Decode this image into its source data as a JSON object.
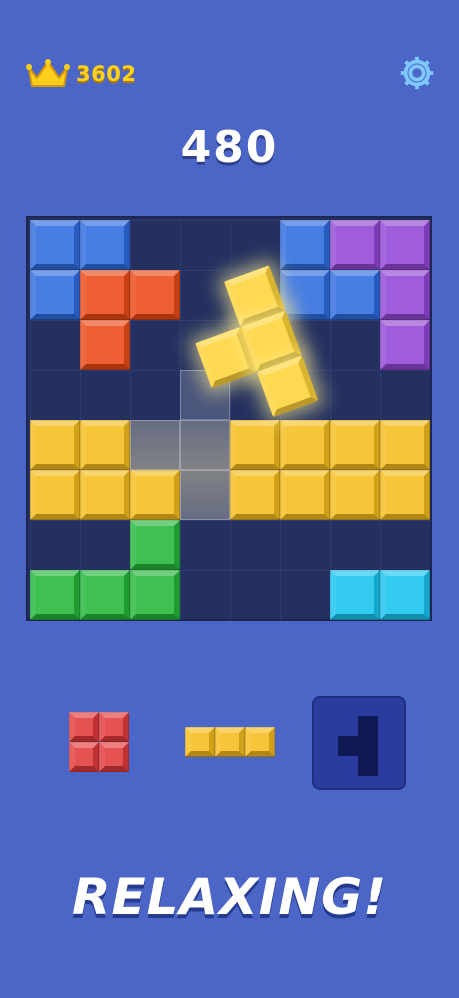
{
  "header": {
    "best_score": "3602",
    "score": "480"
  },
  "board": {
    "colors": {
      "blue": "#2f6ce0",
      "purple": "#9247d6",
      "orange": "#ec4a17",
      "yellow": "#f5bd1e",
      "green": "#25b83a",
      "cyan": "#19c4f0"
    },
    "rows": [
      [
        "blue",
        "blue",
        "",
        "",
        "",
        "blue",
        "purple",
        "purple"
      ],
      [
        "blue",
        "orange",
        "orange",
        "",
        "",
        "blue",
        "blue",
        "purple"
      ],
      [
        "",
        "orange",
        "",
        "",
        "",
        "",
        "",
        "purple"
      ],
      [
        "",
        "",
        "",
        "ghost",
        "",
        "",
        "",
        ""
      ],
      [
        "yellow",
        "yellow",
        "ghost",
        "ghost",
        "yellow",
        "yellow",
        "yellow",
        "yellow"
      ],
      [
        "yellow",
        "yellow",
        "yellow",
        "ghost",
        "yellow",
        "yellow",
        "yellow",
        "yellow"
      ],
      [
        "",
        "",
        "green",
        "",
        "",
        "",
        "",
        ""
      ],
      [
        "green",
        "green",
        "green",
        "",
        "",
        "",
        "cyan",
        "cyan"
      ]
    ]
  },
  "tray": {
    "piece_colors": [
      "red",
      "yellow",
      "dark-navy"
    ]
  },
  "tagline": "RELAXING!",
  "icons": {
    "crown": "crown-icon",
    "settings": "gear-icon"
  }
}
